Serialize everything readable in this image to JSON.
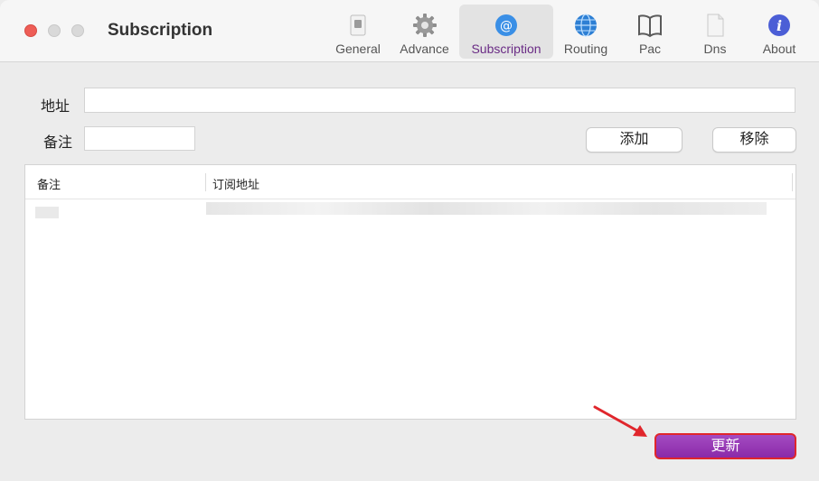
{
  "window": {
    "title": "Subscription"
  },
  "toolbar": {
    "items": [
      {
        "label": "General",
        "icon": "switch-icon"
      },
      {
        "label": "Advance",
        "icon": "gear-icon"
      },
      {
        "label": "Subscription",
        "icon": "at-sign-icon",
        "active": true
      },
      {
        "label": "Routing",
        "icon": "globe-icon"
      },
      {
        "label": "Pac",
        "icon": "book-icon"
      },
      {
        "label": "Dns",
        "icon": "document-icon"
      },
      {
        "label": "About",
        "icon": "info-icon"
      }
    ]
  },
  "form": {
    "address_label": "地址",
    "address_value": "",
    "remark_label": "备注",
    "remark_value": "",
    "add_button": "添加",
    "remove_button": "移除"
  },
  "table": {
    "columns": [
      "备注",
      "订阅地址"
    ]
  },
  "update_button": "更新",
  "colors": {
    "accent": "#8a2aa9",
    "highlight": "#e0262c"
  }
}
